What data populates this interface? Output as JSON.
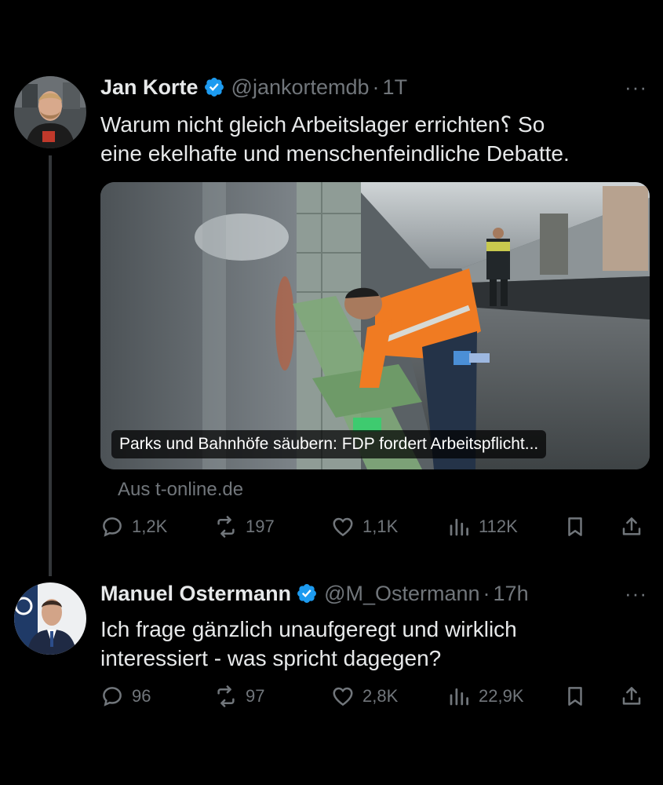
{
  "tweets": [
    {
      "name": "Jan Korte",
      "handle": "@jankortemdb",
      "separator": "·",
      "time": "1T",
      "more": "···",
      "text_line1": "Warum nicht gleich Arbeitslager errichten؟ So",
      "text_line2": "eine ekelhafte und menschenfeindliche Debatte.",
      "card": {
        "caption": "Parks und Bahnhöfe säubern: FDP fordert Arbeitspflicht...",
        "source": "Aus t-online.de"
      },
      "replies": "1,2K",
      "retweets": "197",
      "likes": "1,1K",
      "views": "112K"
    },
    {
      "name": "Manuel Ostermann",
      "handle": "@M_Ostermann",
      "separator": "·",
      "time": "17h",
      "more": "···",
      "text_line1": "Ich frage gänzlich unaufgeregt und wirklich",
      "text_line2": "interessiert - was spricht dagegen?",
      "replies": "96",
      "retweets": "97",
      "likes": "2,8K",
      "views": "22,9K"
    }
  ],
  "colors": {
    "verified": "#1d9bf0",
    "muted": "#71767b",
    "text": "#e7e9ea",
    "background": "#000000"
  }
}
